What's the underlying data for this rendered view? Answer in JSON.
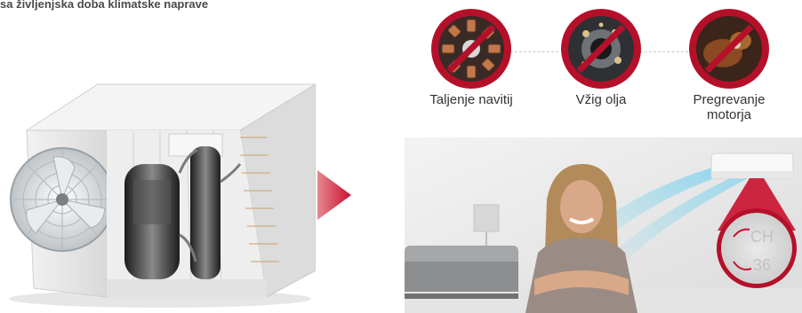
{
  "heading": "sa življenjska doba klimatske naprave",
  "problems": [
    {
      "label": "Taljenje navitij",
      "icon": "melted-coil-icon"
    },
    {
      "label": "Vžig olja",
      "icon": "oil-ignition-icon"
    },
    {
      "label": "Pregrevanje motorja",
      "icon": "motor-overheat-icon"
    }
  ],
  "display": {
    "top": "CH",
    "bottom": "36"
  },
  "colors": {
    "prohibit": "#b5102a",
    "accent": "#c8102e",
    "text": "#333333",
    "airflow": "#7fd3ee"
  }
}
